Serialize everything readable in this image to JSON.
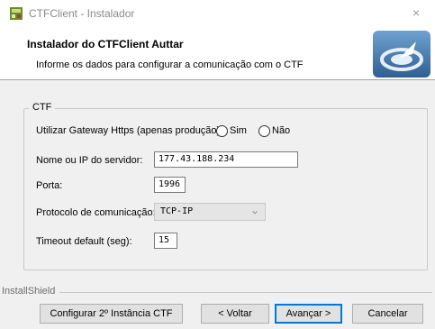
{
  "window": {
    "title": "CTFClient - Instalador",
    "close_glyph": "×"
  },
  "header": {
    "title": "Instalador do CTFClient Auttar",
    "subtitle": "Informe os dados para configurar a comunicação com o CTF",
    "logo_icon": "installer-logo-icon"
  },
  "group": {
    "label": "CTF"
  },
  "gateway": {
    "label": "Utilizar Gateway Https (apenas produção):",
    "option_yes": "Sim",
    "option_no": "Não",
    "selected": "none"
  },
  "fields": {
    "server_label": "Nome ou IP do servidor:",
    "server_value": "177.43.188.234",
    "port_label": "Porta:",
    "port_value": "1996",
    "protocol_label": "Protocolo de comunicação:",
    "protocol_value": "TCP-IP",
    "timeout_label": "Timeout default (seg):",
    "timeout_value": "15"
  },
  "footer": {
    "installshield_label": "InstallShield",
    "btn_configure": "Configurar 2º Instância CTF",
    "btn_back": "< Voltar",
    "btn_next": "Avançar >",
    "btn_cancel": "Cancelar"
  },
  "colors": {
    "accent": "#0078d7",
    "logo_blue": "#3d74a8"
  }
}
